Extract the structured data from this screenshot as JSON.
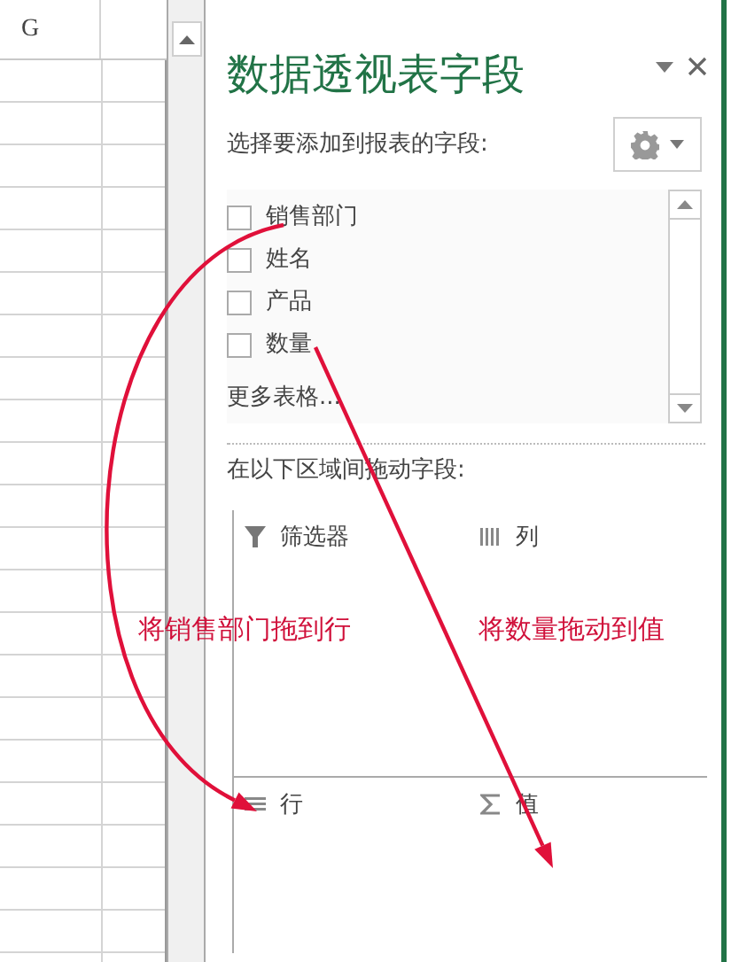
{
  "sheet": {
    "column_header": "G"
  },
  "panel": {
    "title": "数据透视表字段",
    "subtitle": "选择要添加到报表的字段:",
    "fields": [
      {
        "label": "销售部门",
        "checked": false
      },
      {
        "label": "姓名",
        "checked": false
      },
      {
        "label": "产品",
        "checked": false
      },
      {
        "label": "数量",
        "checked": false
      }
    ],
    "more_tables": "更多表格...",
    "drag_hint": "在以下区域间拖动字段:",
    "areas": [
      {
        "kind": "filter",
        "label": "筛选器"
      },
      {
        "kind": "columns",
        "label": "列"
      },
      {
        "kind": "rows",
        "label": "行"
      },
      {
        "kind": "values",
        "label": "值"
      }
    ]
  },
  "annotations": [
    {
      "kind": "curve",
      "text": "将销售部门拖到行"
    },
    {
      "kind": "straight",
      "text": "将数量拖动到值"
    }
  ]
}
